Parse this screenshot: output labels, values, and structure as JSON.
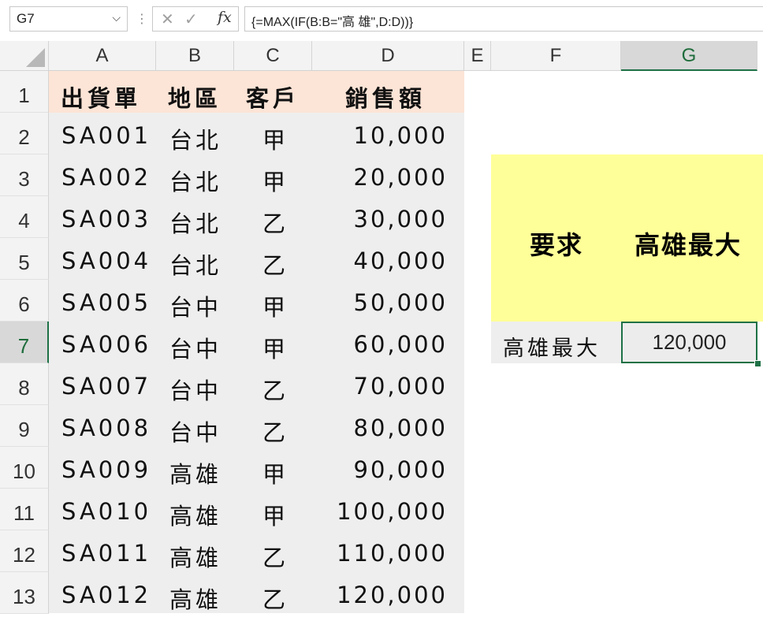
{
  "formula_bar": {
    "name_box": "G7",
    "cancel_icon": "✕",
    "enter_icon": "✓",
    "fx_label": "fx",
    "formula": "{=MAX(IF(B:B=\"高 雄\",D:D))}"
  },
  "columns": [
    "A",
    "B",
    "C",
    "D",
    "E",
    "F",
    "G"
  ],
  "rows": [
    "1",
    "2",
    "3",
    "4",
    "5",
    "6",
    "7",
    "8",
    "9",
    "10",
    "11",
    "12",
    "13"
  ],
  "table": {
    "headers": [
      "出貨單",
      "地區",
      "客戶",
      "銷售額"
    ],
    "rows": [
      [
        "SA001",
        "台北",
        "甲",
        "10,000"
      ],
      [
        "SA002",
        "台北",
        "甲",
        "20,000"
      ],
      [
        "SA003",
        "台北",
        "乙",
        "30,000"
      ],
      [
        "SA004",
        "台北",
        "乙",
        "40,000"
      ],
      [
        "SA005",
        "台中",
        "甲",
        "50,000"
      ],
      [
        "SA006",
        "台中",
        "甲",
        "60,000"
      ],
      [
        "SA007",
        "台中",
        "乙",
        "70,000"
      ],
      [
        "SA008",
        "台中",
        "乙",
        "80,000"
      ],
      [
        "SA009",
        "高雄",
        "甲",
        "90,000"
      ],
      [
        "SA010",
        "高雄",
        "甲",
        "100,000"
      ],
      [
        "SA011",
        "高雄",
        "乙",
        "110,000"
      ],
      [
        "SA012",
        "高雄",
        "乙",
        "120,000"
      ]
    ]
  },
  "side": {
    "req_label": "要求",
    "req_value": "高雄最大",
    "f7": "高雄最大",
    "g7": "120,000"
  },
  "colors": {
    "header_fill": "#fce4d6",
    "yellow_fill": "#ffff99",
    "selection": "#1e7145"
  }
}
